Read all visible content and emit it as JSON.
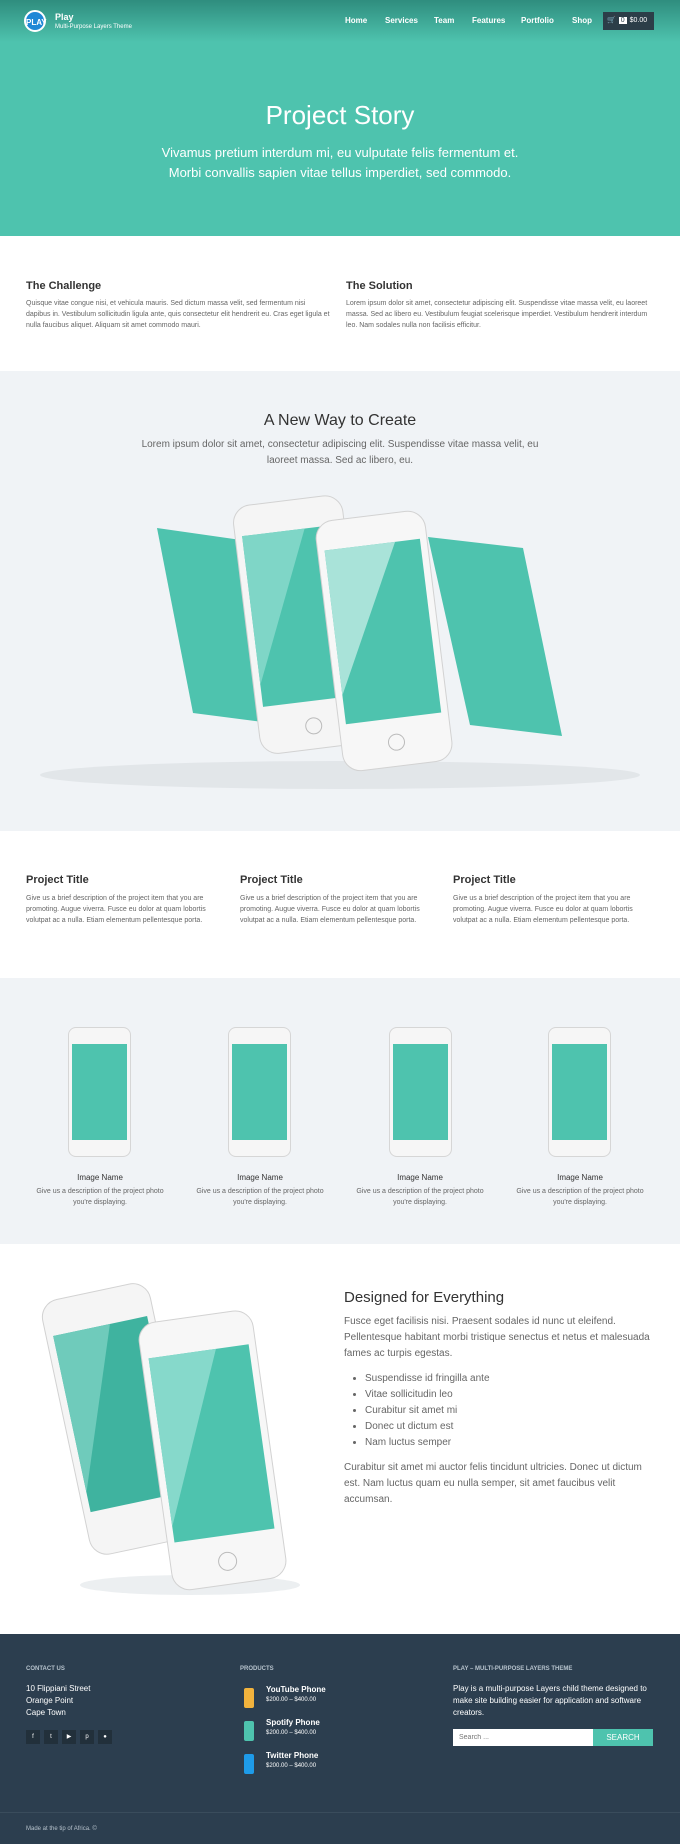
{
  "header": {
    "brand": "Play",
    "tagline": "Multi-Purpose Layers Theme",
    "logo_text": "PLAY",
    "nav": [
      "Home",
      "Services",
      "Team",
      "Features",
      "Portfolio",
      "Shop"
    ],
    "cart": {
      "count": "0",
      "total": "$0.00"
    }
  },
  "hero": {
    "title": "Project Story",
    "subtitle": "Vivamus pretium interdum mi, eu vulputate felis fermentum et. Morbi convallis sapien vitae tellus imperdiet, sed commodo."
  },
  "challenge": {
    "title": "The Challenge",
    "text": "Quisque vitae congue nisi, et vehicula mauris. Sed dictum massa velit, sed fermentum nisi dapibus in. Vestibulum sollicitudin ligula ante, quis consectetur elit hendrerit eu. Cras eget ligula et nulla faucibus aliquet. Aliquam sit amet commodo mauri."
  },
  "solution": {
    "title": "The Solution",
    "text": "Lorem ipsum dolor sit amet, consectetur adipiscing elit. Suspendisse vitae massa velit, eu laoreet massa. Sed ac libero eu. Vestibulum feugiat scelerisque imperdiet. Vestibulum hendrerit interdum leo. Nam sodales nulla non facilisis efficitur."
  },
  "newway": {
    "title": "A New Way to Create",
    "text": "Lorem ipsum dolor sit amet, consectetur adipiscing elit. Suspendisse vitae massa velit, eu laoreet massa. Sed ac libero, eu."
  },
  "projects": [
    {
      "title": "Project Title",
      "text": "Give us a brief description of the project item that you are promoting. Augue viverra. Fusce eu dolor at quam lobortis volutpat ac a nulla. Etiam elementum pellentesque porta."
    },
    {
      "title": "Project Title",
      "text": "Give us a brief description of the project item that you are promoting. Augue viverra. Fusce eu dolor at quam lobortis volutpat ac a nulla. Etiam elementum pellentesque porta."
    },
    {
      "title": "Project Title",
      "text": "Give us a brief description of the project item that you are promoting. Augue viverra. Fusce eu dolor at quam lobortis volutpat ac a nulla. Etiam elementum pellentesque porta."
    }
  ],
  "gallery": [
    {
      "name": "Image Name",
      "desc": "Give us a description of the project photo you're displaying."
    },
    {
      "name": "Image Name",
      "desc": "Give us a description of the project photo you're displaying."
    },
    {
      "name": "Image Name",
      "desc": "Give us a description of the project photo you're displaying."
    },
    {
      "name": "Image Name",
      "desc": "Give us a description of the project photo you're displaying."
    }
  ],
  "designed": {
    "title": "Designed for Everything",
    "intro": "Fusce eget facilisis nisi. Praesent sodales id nunc ut eleifend. Pellentesque habitant morbi tristique senectus et netus et malesuada fames ac turpis egestas.",
    "bullets": [
      "Suspendisse id fringilla ante",
      "Vitae sollicitudin leo",
      "Curabitur sit amet mi",
      "Donec ut dictum est",
      "Nam luctus semper"
    ],
    "outro": "Curabitur sit amet mi auctor felis tincidunt ultricies. Donec ut dictum est. Nam luctus quam eu nulla semper, sit amet faucibus velit accumsan."
  },
  "footer": {
    "contact_heading": "CONTACT US",
    "address": [
      "10 Flippiani Street",
      "Orange Point",
      "Cape Town"
    ],
    "social_icons": [
      "facebook-icon",
      "twitter-icon",
      "youtube-icon",
      "pinterest-icon",
      "dribbble-icon"
    ],
    "products_heading": "PRODUCTS",
    "products": [
      {
        "name": "YouTube Phone",
        "price": "$200.00 – $400.00",
        "color": "#f2b33d"
      },
      {
        "name": "Spotify Phone",
        "price": "$200.00 – $400.00",
        "color": "#4ec3ae"
      },
      {
        "name": "Twitter Phone",
        "price": "$200.00 – $400.00",
        "color": "#1e9be9"
      }
    ],
    "about_heading": "PLAY – MULTI-PURPOSE LAYERS THEME",
    "about_text": "Play is a multi-purpose Layers child theme designed to make site building easier for application and software creators.",
    "search_placeholder": "Search ...",
    "search_button": "SEARCH",
    "copyright": "Made at the tip of Africa. ©"
  },
  "colors": {
    "accent": "#4ec3ae",
    "footer": "#2c3e4f"
  }
}
